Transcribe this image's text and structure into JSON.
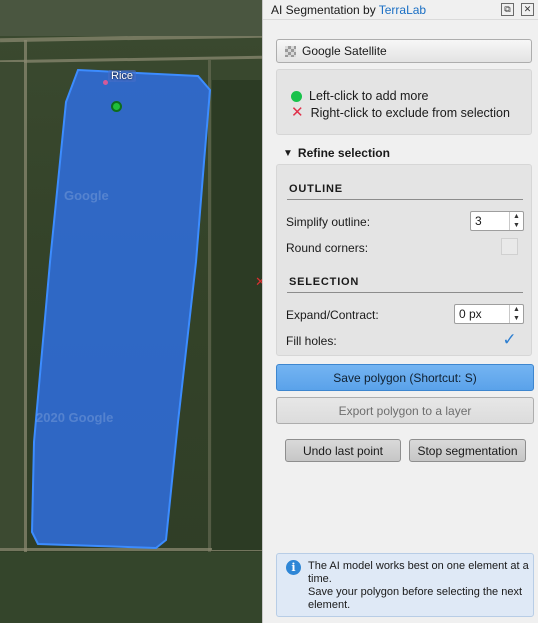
{
  "map": {
    "polygon_label": "Rice",
    "watermarks": [
      "Google",
      "2020 Google"
    ],
    "colors": {
      "polygon_fill": "#2f6fe0",
      "polygon_stroke": "#3c8cff",
      "point": "#1fbf3a"
    }
  },
  "panel": {
    "title": "AI Segmentation by",
    "title_brand": "TerraLab",
    "window_buttons": {
      "float": "⧉",
      "close": "✕"
    },
    "basemap_button": "Google Satellite",
    "hints": {
      "add": "Left-click to add more",
      "exclude": "Right-click to exclude from selection"
    },
    "refine": {
      "header": "Refine selection",
      "outline": {
        "title": "OUTLINE",
        "simplify_label": "Simplify outline:",
        "simplify_value": "3",
        "round_label": "Round corners:",
        "round_checked": false
      },
      "selection": {
        "title": "SELECTION",
        "expand_label": "Expand/Contract:",
        "expand_value": "0 px",
        "fill_label": "Fill holes:",
        "fill_checked": true
      }
    },
    "buttons": {
      "save": "Save polygon  (Shortcut: S)",
      "export": "Export polygon to a layer",
      "undo": "Undo last point",
      "stop": "Stop segmentation"
    },
    "info": {
      "icon": "i",
      "text_line1": "The AI model works best on one element at a time.",
      "text_line2": "Save your polygon before selecting the next element."
    },
    "colors": {
      "accent": "#5aa2ea",
      "brand": "#1a6fc4",
      "add_dot": "#19c24b",
      "exclude_x": "#e0304a",
      "info_bg": "#dfe9f6"
    }
  }
}
